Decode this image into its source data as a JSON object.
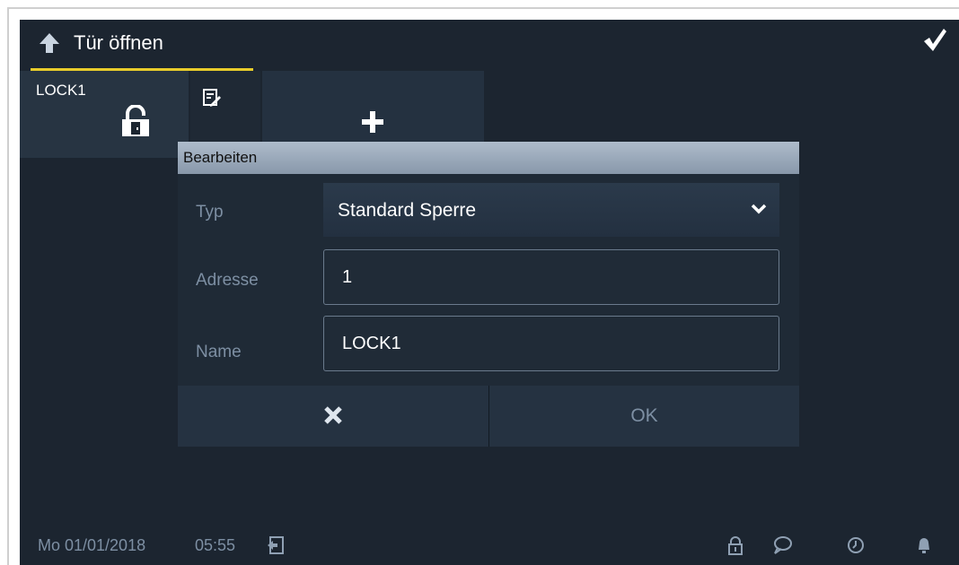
{
  "header": {
    "title": "Tür öffnen",
    "back_icon": "back-arrow-icon",
    "confirm_icon": "checkmark-icon",
    "accent_color": "#e8cc2b"
  },
  "lock_tiles": [
    {
      "label": "LOCK1",
      "icon": "door-lock-icon"
    }
  ],
  "tile_actions": {
    "edit_icon": "edit-icon",
    "add_icon": "plus-icon"
  },
  "dialog": {
    "title": "Bearbeiten",
    "fields": {
      "type": {
        "label": "Typ",
        "value": "Standard Sperre"
      },
      "address": {
        "label": "Adresse",
        "value": "1"
      },
      "name": {
        "label": "Name",
        "value": "LOCK1"
      }
    },
    "cancel_icon": "close-icon",
    "ok_label": "OK"
  },
  "status_bar": {
    "date": "Mo 01/01/2018",
    "time": "05:55",
    "icons": [
      "logout-icon",
      "lock-icon",
      "message-icon",
      "history-icon",
      "bell-icon"
    ]
  }
}
